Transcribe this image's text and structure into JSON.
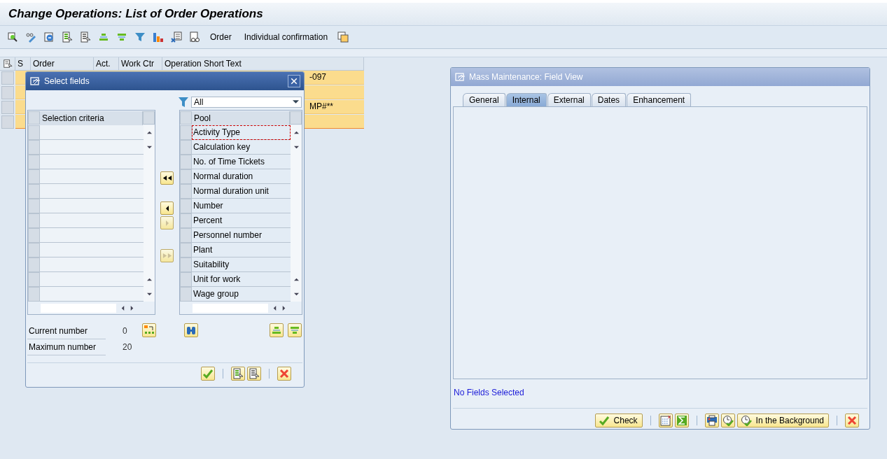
{
  "window": {
    "title": "Change Operations: List of Order Operations"
  },
  "toolbar": {
    "buttons": [
      "Order",
      "Individual confirmation"
    ]
  },
  "table": {
    "columns": [
      "S",
      "Order",
      "Act.",
      "Work Ctr",
      "Operation Short Text"
    ],
    "rows": [
      {
        "fragment": "-097"
      },
      {},
      {
        "fragment": "MP#**"
      },
      {}
    ]
  },
  "select_fields": {
    "title": "Select fields",
    "filter": {
      "value": "All"
    },
    "selection_criteria": {
      "heading": "Selection criteria"
    },
    "pool": {
      "heading": "Pool",
      "items": [
        {
          "label": "Activity Type",
          "focused": true
        },
        {
          "label": "Calculation key",
          "focused": false
        },
        {
          "label": "No. of Time Tickets",
          "focused": false
        },
        {
          "label": "Normal duration",
          "focused": false
        },
        {
          "label": "Normal duration unit",
          "focused": false
        },
        {
          "label": "Number",
          "focused": false
        },
        {
          "label": "Percent",
          "focused": false
        },
        {
          "label": "Personnel number",
          "focused": false
        },
        {
          "label": "Plant",
          "focused": false
        },
        {
          "label": "Suitability",
          "focused": false
        },
        {
          "label": "Unit for work",
          "focused": false
        },
        {
          "label": "Wage group",
          "focused": false
        }
      ]
    },
    "counts": [
      {
        "label": "Current number",
        "value": "0"
      },
      {
        "label": "Maximum number",
        "value": "20"
      }
    ]
  },
  "mass_maintenance": {
    "title": "Mass Maintenance: Field View",
    "tabs": [
      {
        "label": "General",
        "selected": false
      },
      {
        "label": "Internal",
        "selected": true
      },
      {
        "label": "External",
        "selected": false
      },
      {
        "label": "Dates",
        "selected": false
      },
      {
        "label": "Enhancement",
        "selected": false
      }
    ],
    "message": "No Fields Selected",
    "buttons": [
      {
        "kind": "check",
        "label": "Check"
      },
      {
        "kind": "background",
        "label": "In the Background"
      }
    ]
  }
}
